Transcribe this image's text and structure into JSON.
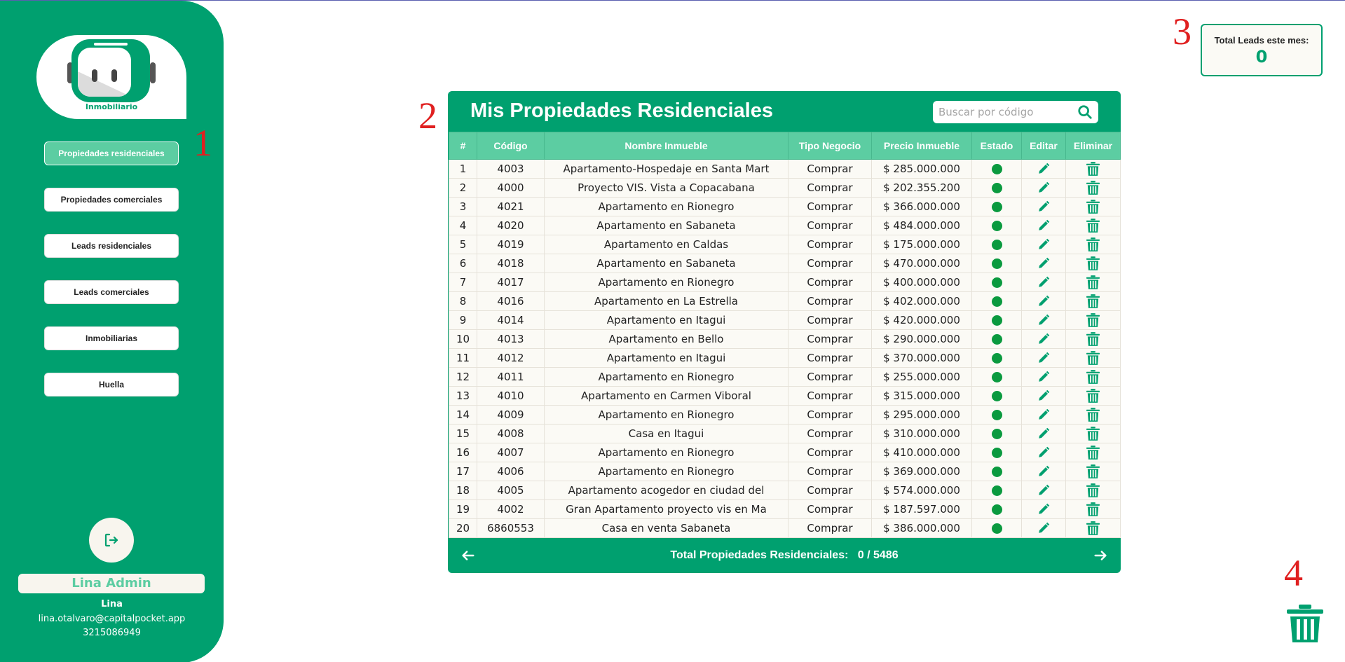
{
  "sidebar": {
    "logo_label": "Inmobiliario",
    "nav": [
      {
        "label": "Propiedades residenciales",
        "active": true
      },
      {
        "label": "Propiedades comerciales",
        "active": false
      },
      {
        "label": "Leads residenciales",
        "active": false
      },
      {
        "label": "Leads comerciales",
        "active": false
      },
      {
        "label": "Inmobiliarias",
        "active": false
      },
      {
        "label": "Huella",
        "active": false
      }
    ],
    "logout_icon": "logout-icon",
    "user": {
      "display": "Lina Admin",
      "name": "Lina",
      "email": "lina.otalvaro@capitalpocket.app",
      "phone": "3215086949"
    }
  },
  "annotations": [
    "1",
    "2",
    "3",
    "4"
  ],
  "leads": {
    "label": "Total Leads este mes:",
    "count": "0"
  },
  "main": {
    "title": "Mis Propiedades Residenciales",
    "search_placeholder": "Buscar por código",
    "columns": [
      "#",
      "Código",
      "Nombre Inmueble",
      "Tipo Negocio",
      "Precio Inmueble",
      "Estado",
      "Editar",
      "Eliminar"
    ],
    "rows": [
      {
        "n": "1",
        "code": "4003",
        "name": "Apartamento-Hospedaje en Santa Mart",
        "type": "Comprar",
        "price": "$ 285.000.000"
      },
      {
        "n": "2",
        "code": "4000",
        "name": "Proyecto VIS. Vista a Copacabana",
        "type": "Comprar",
        "price": "$ 202.355.200"
      },
      {
        "n": "3",
        "code": "4021",
        "name": "Apartamento en Rionegro",
        "type": "Comprar",
        "price": "$ 366.000.000"
      },
      {
        "n": "4",
        "code": "4020",
        "name": "Apartamento en Sabaneta",
        "type": "Comprar",
        "price": "$ 484.000.000"
      },
      {
        "n": "5",
        "code": "4019",
        "name": "Apartamento en Caldas",
        "type": "Comprar",
        "price": "$ 175.000.000"
      },
      {
        "n": "6",
        "code": "4018",
        "name": "Apartamento en Sabaneta",
        "type": "Comprar",
        "price": "$ 470.000.000"
      },
      {
        "n": "7",
        "code": "4017",
        "name": "Apartamento en Rionegro",
        "type": "Comprar",
        "price": "$ 400.000.000"
      },
      {
        "n": "8",
        "code": "4016",
        "name": "Apartamento en La Estrella",
        "type": "Comprar",
        "price": "$ 402.000.000"
      },
      {
        "n": "9",
        "code": "4014",
        "name": "Apartamento en Itagui",
        "type": "Comprar",
        "price": "$ 420.000.000"
      },
      {
        "n": "10",
        "code": "4013",
        "name": "Apartamento en Bello",
        "type": "Comprar",
        "price": "$ 290.000.000"
      },
      {
        "n": "11",
        "code": "4012",
        "name": "Apartamento en Itagui",
        "type": "Comprar",
        "price": "$ 370.000.000"
      },
      {
        "n": "12",
        "code": "4011",
        "name": "Apartamento en Rionegro",
        "type": "Comprar",
        "price": "$ 255.000.000"
      },
      {
        "n": "13",
        "code": "4010",
        "name": "Apartamento en Carmen Viboral",
        "type": "Comprar",
        "price": "$ 315.000.000"
      },
      {
        "n": "14",
        "code": "4009",
        "name": "Apartamento en Rionegro",
        "type": "Comprar",
        "price": "$ 295.000.000"
      },
      {
        "n": "15",
        "code": "4008",
        "name": "Casa en Itagui",
        "type": "Comprar",
        "price": "$ 310.000.000"
      },
      {
        "n": "16",
        "code": "4007",
        "name": "Apartamento en Rionegro",
        "type": "Comprar",
        "price": "$ 410.000.000"
      },
      {
        "n": "17",
        "code": "4006",
        "name": "Apartamento en Rionegro",
        "type": "Comprar",
        "price": "$ 369.000.000"
      },
      {
        "n": "18",
        "code": "4005",
        "name": "Apartamento acogedor en ciudad del",
        "type": "Comprar",
        "price": "$ 574.000.000"
      },
      {
        "n": "19",
        "code": "4002",
        "name": "Gran Apartamento proyecto vis en Ma",
        "type": "Comprar",
        "price": "$ 187.597.000"
      },
      {
        "n": "20",
        "code": "6860553",
        "name": "Casa en venta Sabaneta",
        "type": "Comprar",
        "price": "$ 386.000.000"
      }
    ],
    "footer": {
      "label": "Total Propiedades Residenciales:",
      "value": "0 / 5486"
    }
  },
  "colors": {
    "primary": "#00a06f",
    "header": "#5ccda2",
    "status_dot": "#0a9a3f",
    "row_bg": "#fbfaf5",
    "annotation": "#e02020"
  }
}
